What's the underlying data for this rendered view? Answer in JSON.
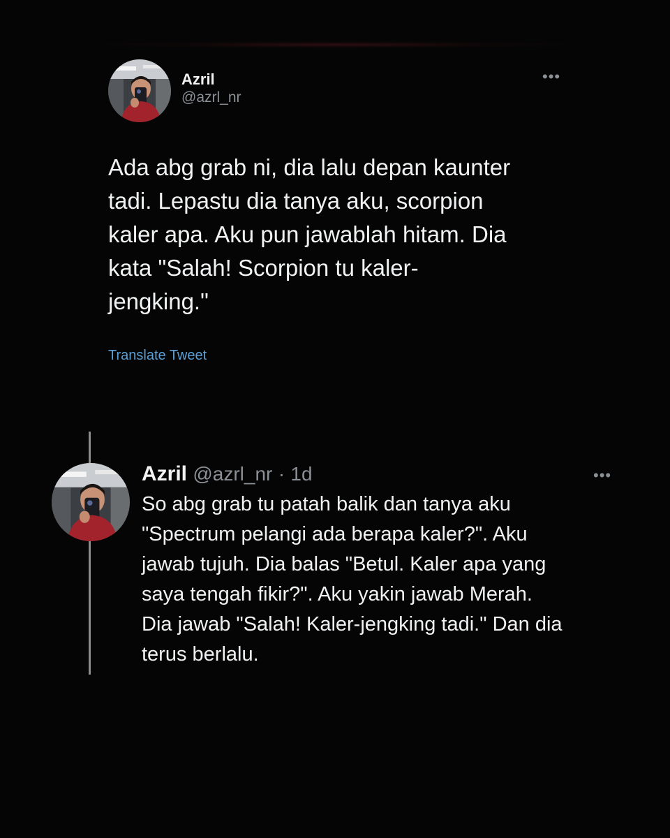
{
  "main_tweet": {
    "display_name": "Azril",
    "handle": "@azrl_nr",
    "more_icon": "•••",
    "text": "Ada abg grab ni, dia lalu depan kaunter\ntadi. Lepastu dia tanya aku, scorpion\nkaler apa. Aku pun jawablah hitam. Dia\nkata \"Salah! Scorpion tu kaler-\njengking.\"",
    "translate_label": "Translate Tweet"
  },
  "reply_tweet": {
    "display_name": "Azril",
    "handle": "@azrl_nr",
    "separator": "·",
    "time": "1d",
    "more_icon": "•••",
    "text": "So abg grab tu patah balik dan tanya aku\n\"Spectrum pelangi ada berapa kaler?\". Aku\njawab tujuh. Dia balas \"Betul. Kaler apa yang\nsaya tengah fikir?\". Aku yakin jawab Merah.\nDia jawab \"Salah! Kaler-jengking tadi.\" Dan dia\nterus berlalu."
  },
  "colors": {
    "background": "#050505",
    "text": "#f0f1f2",
    "secondary": "#8b9096",
    "link": "#5b9fd6"
  }
}
